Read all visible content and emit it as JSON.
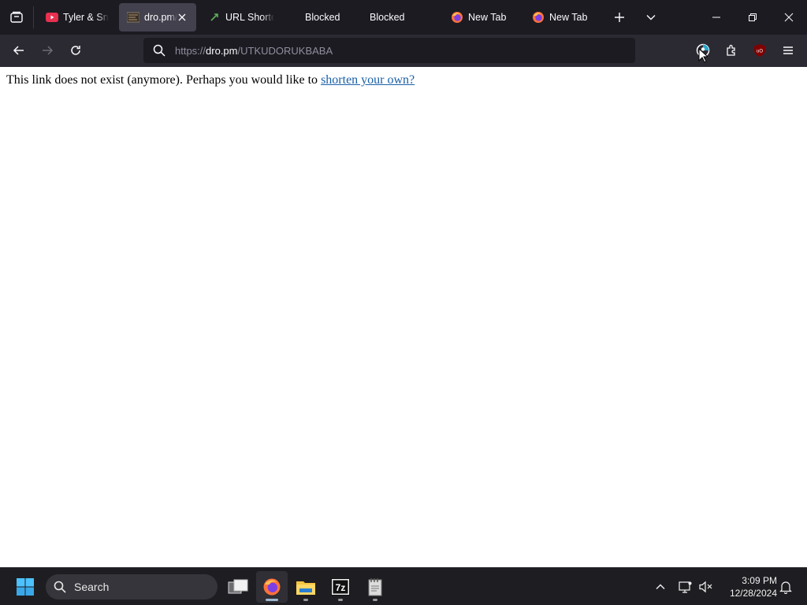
{
  "browser": {
    "tabs": [
      {
        "title": "Tyler & Sn",
        "favicon": "youtube-icon",
        "active": false
      },
      {
        "title": "dro.pm/",
        "favicon": "dro-pm-favicon",
        "active": true
      },
      {
        "title": "URL Shorte",
        "favicon": "url-shortener-favicon",
        "active": false
      },
      {
        "title": "Blocked",
        "favicon": "none",
        "active": false
      },
      {
        "title": "Blocked",
        "favicon": "none",
        "active": false
      },
      {
        "title": "New Tab",
        "favicon": "firefox-icon",
        "active": false
      },
      {
        "title": "New Tab",
        "favicon": "firefox-icon",
        "active": false
      }
    ],
    "url": {
      "scheme": "https://",
      "host": "dro.pm",
      "path": "/UTKUDORUKBABA"
    },
    "toolbar_icons": [
      "account-icon",
      "extensions-icon",
      "ublock-icon",
      "menu-icon"
    ],
    "ublock_label": "uO"
  },
  "page": {
    "message": "This link does not exist (anymore). Perhaps you would like to ",
    "link_text": "shorten your own?"
  },
  "taskbar": {
    "search_label": "Search",
    "pinned": [
      "windows-start-icon",
      "task-view-icon",
      "firefox-icon",
      "file-explorer-icon",
      "7zip-icon",
      "notepad-icon"
    ],
    "sevenzip_label": "7z",
    "clock": {
      "time": "3:09 PM",
      "date": "12/28/2024"
    }
  },
  "colors": {
    "tab_strip": "#1c1b22",
    "nav_bar": "#2b2a33",
    "active_tab": "#42414d",
    "link": "#1a5fa8",
    "taskbar": "#1e1e22"
  }
}
